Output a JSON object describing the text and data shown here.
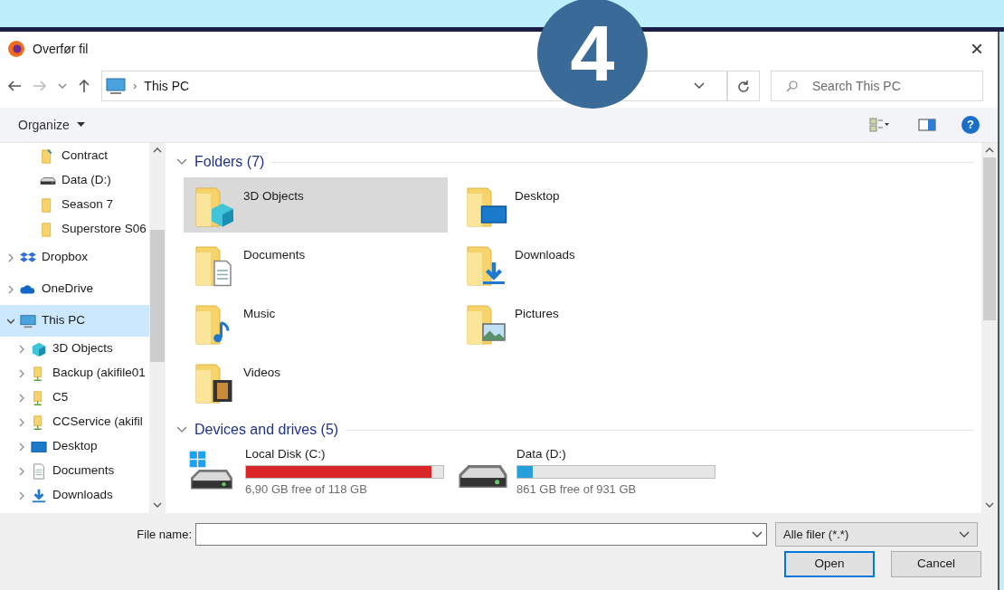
{
  "badge": {
    "text": "4"
  },
  "window": {
    "title": "Overfør fil",
    "close": "×"
  },
  "address_bar": {
    "separator": "›",
    "path": "This PC"
  },
  "help": {
    "text": "?"
  },
  "search": {
    "placeholder": "Search This PC"
  },
  "toolbar": {
    "organize": "Organize"
  },
  "sidebar": {
    "items": [
      {
        "label": "Contract",
        "kind": "folder-doc",
        "selected": false
      },
      {
        "label": "Data (D:)",
        "kind": "drive",
        "selected": false
      },
      {
        "label": "Season 7",
        "kind": "folder",
        "selected": false
      },
      {
        "label": "Superstore S06",
        "kind": "folder",
        "selected": false
      },
      {
        "label": "Dropbox",
        "kind": "dropbox",
        "selected": false,
        "expanded": false
      },
      {
        "label": "OneDrive",
        "kind": "cloud",
        "selected": false,
        "expanded": false
      },
      {
        "label": "This PC",
        "kind": "pc",
        "selected": true,
        "expanded": true,
        "children": [
          {
            "label": "3D Objects",
            "kind": "cube",
            "selected": false,
            "expanded": false
          },
          {
            "label": "Backup (akifile01",
            "kind": "netfolder",
            "selected": false,
            "expanded": false
          },
          {
            "label": "C5",
            "kind": "netfolder",
            "selected": false,
            "expanded": false
          },
          {
            "label": "CCService (akifil",
            "kind": "netfolder",
            "selected": false,
            "expanded": false
          },
          {
            "label": "Desktop",
            "kind": "desktop",
            "selected": false,
            "expanded": false
          },
          {
            "label": "Documents",
            "kind": "documents",
            "selected": false,
            "expanded": false
          },
          {
            "label": "Downloads",
            "kind": "downloads",
            "selected": false,
            "expanded": false
          }
        ]
      }
    ]
  },
  "groups": [
    {
      "title": "Folders (7)",
      "expanded": true,
      "kind": "folders",
      "items": [
        {
          "label": "3D Objects",
          "kind": "cube",
          "selected": true
        },
        {
          "label": "Desktop",
          "kind": "desktop",
          "selected": false
        },
        {
          "label": "Documents",
          "kind": "documents",
          "selected": false
        },
        {
          "label": "Downloads",
          "kind": "downloads",
          "selected": false
        },
        {
          "label": "Music",
          "kind": "music",
          "selected": false
        },
        {
          "label": "Pictures",
          "kind": "pictures",
          "selected": false
        },
        {
          "label": "Videos",
          "kind": "videos",
          "selected": false
        }
      ]
    },
    {
      "title": "Devices and drives (5)",
      "expanded": true,
      "kind": "drives",
      "items": [
        {
          "label": "Local Disk (C:)",
          "kind": "windows-drive",
          "level": 0.94,
          "reading": "6,90 GB free of 118 GB",
          "color": "#da2626",
          "selected": false
        },
        {
          "label": "Data (D:)",
          "kind": "drive",
          "level": 0.08,
          "reading": "861 GB free of 931 GB",
          "color": "#26a0da",
          "selected": false
        }
      ]
    }
  ],
  "footer": {
    "file_name_label": "File name:",
    "filter": "Alle filer (*.*)",
    "buttons": [
      {
        "label": "Open",
        "default": true
      },
      {
        "label": "Cancel",
        "default": false
      }
    ]
  }
}
